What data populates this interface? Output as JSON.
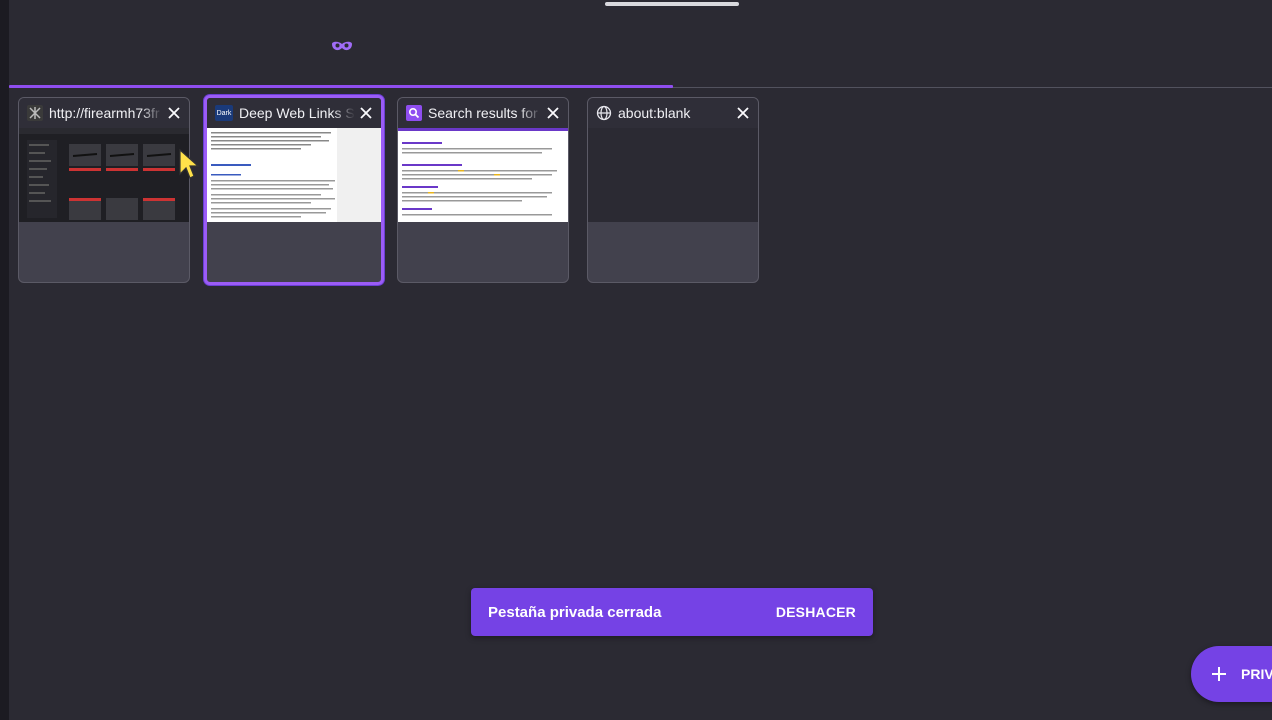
{
  "colors": {
    "background": "#2b2a33",
    "accent": "#7542e5",
    "selected_border": "#9b5cf6"
  },
  "header": {
    "private_mode_icon": "private-mask-icon"
  },
  "tabs": [
    {
      "title": "http://firearmh73fr",
      "favicon": "site-favicon-icon",
      "close_icon": "close-icon",
      "selected": false
    },
    {
      "title": "Deep Web Links S",
      "favicon_text": "Dark",
      "close_icon": "close-icon",
      "selected": true
    },
    {
      "title": "Search results for",
      "favicon": "search-icon",
      "close_icon": "close-icon",
      "selected": false
    },
    {
      "title": "about:blank",
      "favicon": "globe-icon",
      "close_icon": "close-icon",
      "selected": false
    }
  ],
  "snackbar": {
    "message": "Pestaña privada cerrada",
    "action": "DESHACER"
  },
  "fab": {
    "label": "PRIV",
    "icon": "plus-icon"
  }
}
